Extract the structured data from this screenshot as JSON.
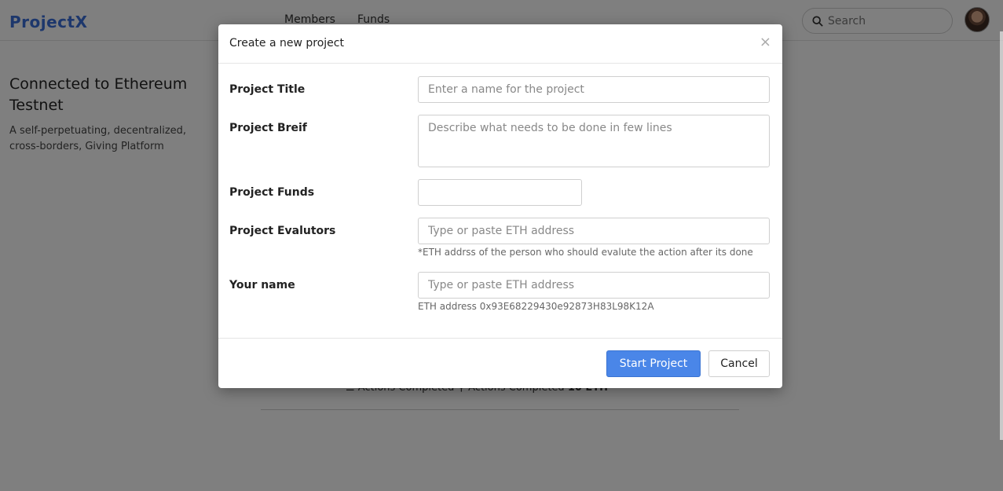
{
  "header": {
    "brand": "ProjectX",
    "nav": [
      "Members",
      "Funds"
    ],
    "search_label": "Search"
  },
  "sidebar": {
    "title": "Connected to Ethereum Testnet",
    "description": "A self-perpetuating, decentralized, cross-borders, Giving Platform"
  },
  "background": {
    "actions_completed_1": "Actions Completed",
    "actions_completed_2": "Actions Completed",
    "funds": "10 ETH"
  },
  "modal": {
    "title": "Create a new project",
    "close_label": "×",
    "fields": {
      "title_label": "Project Title",
      "title_placeholder": "Enter a name for the project",
      "brief_label": "Project Breif",
      "brief_placeholder": "Describe what needs to be done in few lines",
      "funds_label": "Project Funds",
      "funds_value": "",
      "evaluators_label": "Project Evalutors",
      "evaluators_placeholder": "Type or paste ETH address",
      "evaluators_help": "*ETH addrss of the person who should evalute the action after its done",
      "name_label": "Your name",
      "name_placeholder": "Type or paste ETH address",
      "name_help": "ETH address 0x93E68229430e92873H83L98K12A"
    },
    "footer": {
      "start_label": "Start Project",
      "cancel_label": "Cancel"
    }
  },
  "colors": {
    "brand": "#3b6fd8",
    "primary_button": "#4a86e8",
    "overlay": "rgba(0,0,0,0.5)"
  }
}
